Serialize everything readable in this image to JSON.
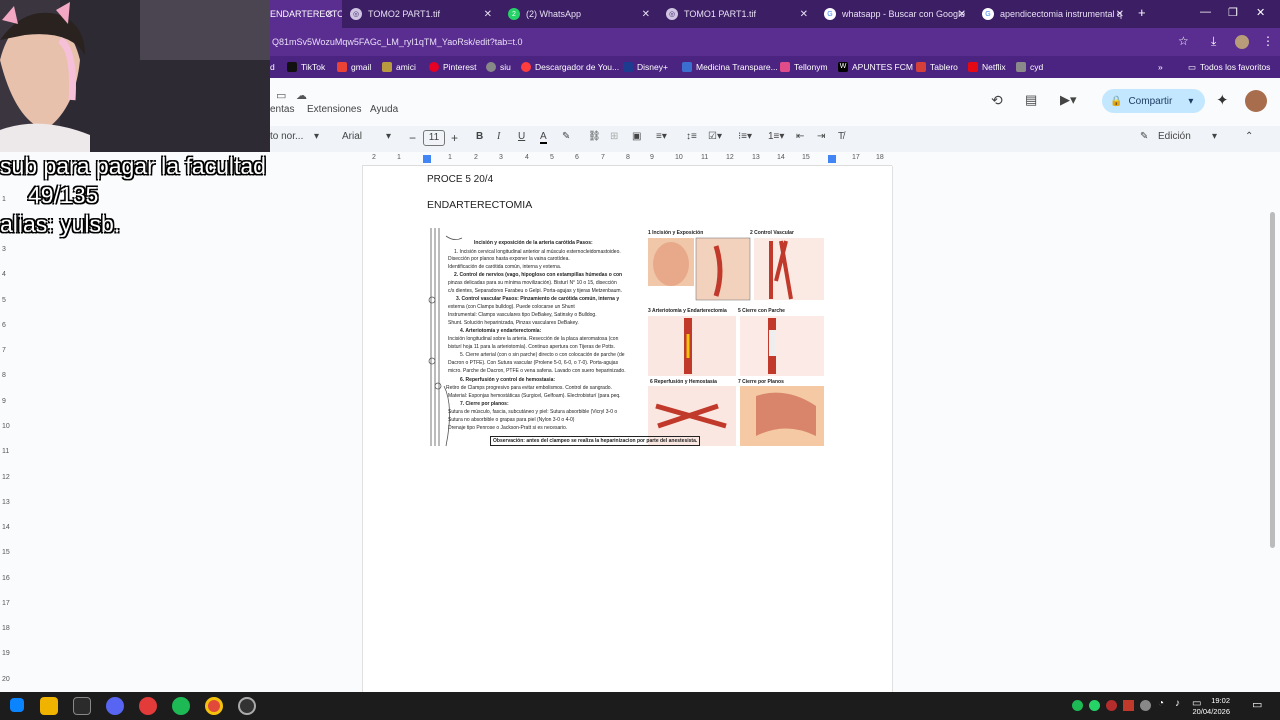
{
  "tabs": [
    {
      "label": "ENDARTERECTOMÍA",
      "active": true
    },
    {
      "label": "TOMO2 PART1.tif"
    },
    {
      "label": "(2) WhatsApp"
    },
    {
      "label": "TOMO1 PART1.tif"
    },
    {
      "label": "whatsapp - Buscar con Google"
    },
    {
      "label": "apendicectomia instrumental q"
    }
  ],
  "address": "Q81mSv5WozuMqw5FAGc_LM_ryI1qTM_YaoRsk/edit?tab=t.0",
  "bookmarks": [
    {
      "label": "d"
    },
    {
      "label": "TikTok",
      "color": "#111111"
    },
    {
      "label": "gmail",
      "color": "#ea4335"
    },
    {
      "label": "amici",
      "color": "#b79b3e"
    },
    {
      "label": "Pinterest",
      "color": "#e60023"
    },
    {
      "label": "siu",
      "color": "#888888"
    },
    {
      "label": "Descargador de You...",
      "color": "#ff3d3d"
    },
    {
      "label": "Disney+",
      "color": "#1d3b8f"
    },
    {
      "label": "Medicina Transpare...",
      "color": "#3b6fcf"
    },
    {
      "label": "Tellonym",
      "color": "#e04b8a"
    },
    {
      "label": "APUNTES FCM",
      "color": "#000000"
    },
    {
      "label": "Tablero",
      "color": "#d43f3a"
    },
    {
      "label": "Netflix",
      "color": "#e50914"
    },
    {
      "label": "cyd",
      "color": "#8a8a8a"
    }
  ],
  "bookmarks_all": "Todos los favoritos",
  "menus": [
    "entas",
    "Extensiones",
    "Ayuda"
  ],
  "share_label": "Compartir",
  "toolbar": {
    "style": "to nor...",
    "font": "Arial",
    "size": "11",
    "mode": "Edición"
  },
  "ruler_ticks": [
    "2",
    "1",
    "1",
    "2",
    "3",
    "4",
    "5",
    "6",
    "7",
    "8",
    "9",
    "10",
    "11",
    "12",
    "13",
    "14",
    "15",
    "16",
    "17",
    "18"
  ],
  "left_ruler": [
    "1",
    "2",
    "3",
    "4",
    "5",
    "6",
    "7",
    "8",
    "9",
    "10",
    "11",
    "12",
    "13",
    "14",
    "15",
    "16",
    "17",
    "18",
    "19",
    "20"
  ],
  "doc": {
    "line1": "PROCE 5   20/4",
    "heading": "ENDARTERECTOMIA"
  },
  "figure": {
    "title1": "Incisión y exposición de la arteria carótida Pasos:",
    "text": [
      "1. Incisión cervical longitudinal anterior al músculo esternocleidomastoideo.",
      "Disección por planos hasta exponer la vaina carotídea.",
      "Identificación de carótida común, interna y externa.",
      "2. Control de nervios (vago, hipogloso con estampillas húmedas o con",
      "pinzas delicadas para su mínima movilización). Bisturí N° 10 o 15, disección",
      "c/s dientes, Separadores Farabeu o Gelpi. Porta-agujas y tijeras Metzenbaum.",
      "3. Control vascular Pasos: Pinzamiento de carótida común, interna y",
      "externa (con Clamps bulldog). Puede colocarse un Shunt",
      "Instrumental: Clamps vasculares tipo DeBakey, Satinsky o Bulldog.",
      "Shunt. Solución heparinizada, Pinzas vasculares DeBakey.",
      "4. Arteriotomía y endarterectomía:",
      "Incisión longitudinal sobre la arteria. Resección de la placa ateromatosa (con",
      "bisturí hoja 11 para la arteriotomía). Continuo apertura con Tijeras de Potts.",
      "5. Cierre arterial (con o sin parche) directo o con colocación de parche (de",
      "Dacron o PTFE). Con Sutura vascular (Prolene 5-0, 6-0, o 7-0). Porta-agujas",
      "micro. Parche de Dacron, PTFE o vena safena. Lavado con suero heparinizado.",
      "6. Reperfusión y control de hemostasia:",
      "Retiro de Clamps progresivo para evitar embolismos. Control de sangrado.",
      "Material: Esponjas hemostáticas (Surgicel, Gelfoam). Electrobisturí (para peq.",
      "7. Cierre por planos:",
      "Sutura de músculo, fascia, subcutáneo y piel: Sutura absorbible (Vicryl 3-0 o",
      "Sutura no absorbible o grapas para piel (Nylon 3-0 o 4-0)",
      "Drenaje tipo Penrose o Jackson-Pratt si es necesario."
    ],
    "note": "Observación: antes del clampeo se realiza la heparinizacion por parte del anestesista.",
    "panels": [
      "1 Incisión y Exposición",
      "2 Control Vascular",
      "3 Arteriotomía y Endarterectomía",
      "5 Cierre con Parche",
      "6 Reperfusión y Hemostasia",
      "7 Cierre por Planos"
    ]
  },
  "overlay": {
    "line1": "sub para pagar la facultad",
    "line2": "49/135",
    "line3": "alias: yulsb."
  },
  "clock": {
    "time": "19:02",
    "date": "20/04/2026"
  }
}
